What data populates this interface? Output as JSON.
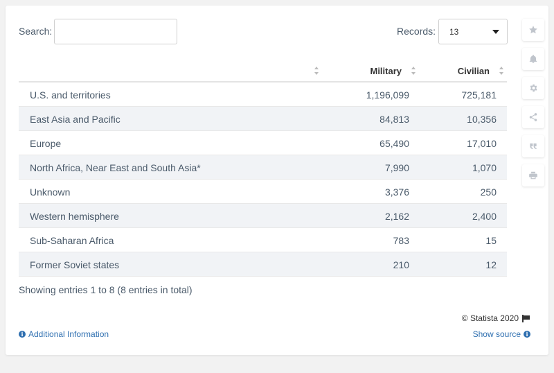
{
  "search": {
    "label": "Search:",
    "value": "",
    "placeholder": ""
  },
  "records": {
    "label": "Records:",
    "selected": "13"
  },
  "table": {
    "columns": [
      "",
      "Military",
      "Civilian"
    ],
    "rows": [
      [
        "U.S. and territories",
        "1,196,099",
        "725,181"
      ],
      [
        "East Asia and Pacific",
        "84,813",
        "10,356"
      ],
      [
        "Europe",
        "65,490",
        "17,010"
      ],
      [
        "North Africa, Near East and South Asia*",
        "7,990",
        "1,070"
      ],
      [
        "Unknown",
        "3,376",
        "250"
      ],
      [
        "Western hemisphere",
        "2,162",
        "2,400"
      ],
      [
        "Sub-Saharan Africa",
        "783",
        "15"
      ],
      [
        "Former Soviet states",
        "210",
        "12"
      ]
    ]
  },
  "footer": {
    "showing": "Showing entries 1 to 8 (8 entries in total)",
    "copyright": "© Statista 2020",
    "additional_info": "Additional Information",
    "show_source": "Show source"
  },
  "toolbar_icons": [
    "star-icon",
    "bell-icon",
    "gear-icon",
    "share-icon",
    "quote-icon",
    "print-icon"
  ],
  "colors": {
    "link": "#2e6fb0",
    "row_alt": "#f1f3f6"
  }
}
